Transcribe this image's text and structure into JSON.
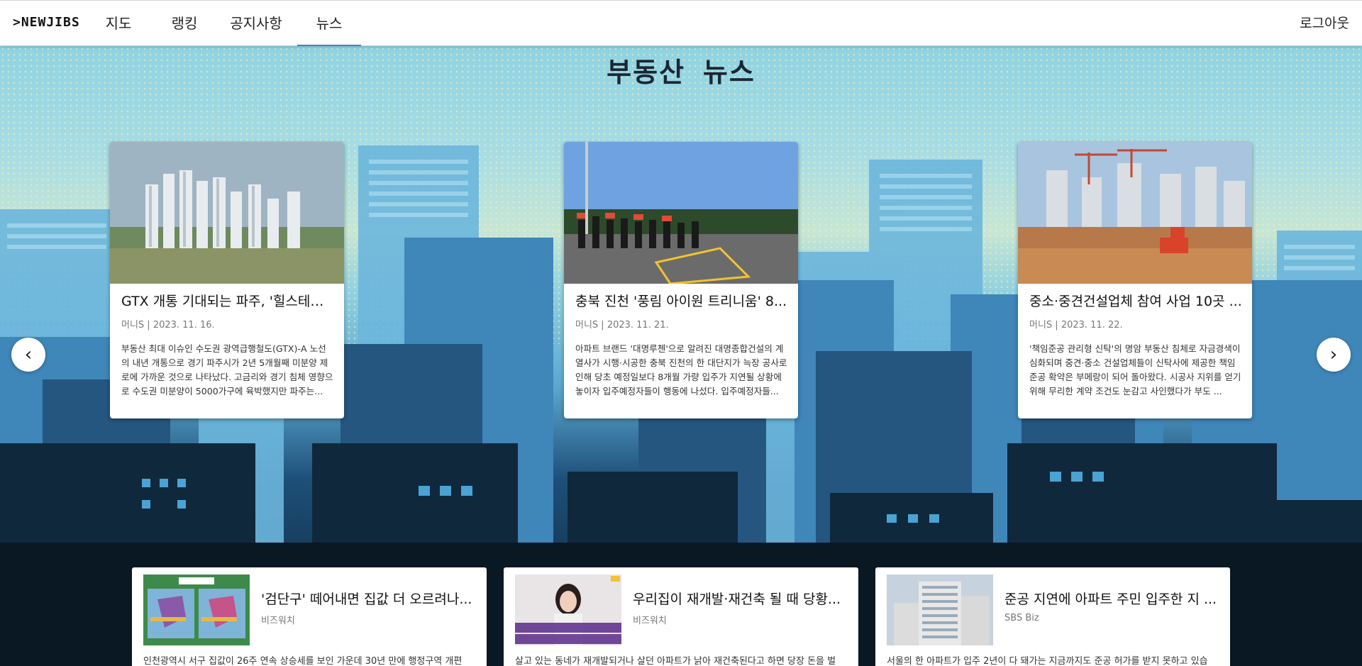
{
  "nav": {
    "logo": ">NEWJIBS",
    "items": [
      {
        "label": "지도"
      },
      {
        "label": "랭킹"
      },
      {
        "label": "공지사항"
      },
      {
        "label": "뉴스"
      }
    ],
    "active": "뉴스",
    "logout": "로그아웃"
  },
  "hero": {
    "title": "부동산 뉴스"
  },
  "cards": [
    {
      "title": "GTX 개통 기대되는 파주, '힐스테이...",
      "meta": "머니S | 2023. 11. 16.",
      "desc": "부동산 최대 이슈인 수도권 광역급행철도(GTX)-A 노선의 내년 개통으로 경기 파주시가 2년 5개월째 미분양 제로에 가까운 것으로 나타났다. 고금리와 경기 침체 영향으로 수도권 미분양이 5000가구에 육박했지만 파주는..."
    },
    {
      "title": "충북 진천 '풍림 아이원 트리니움' 8...",
      "meta": "머니S | 2023. 11. 21.",
      "desc": "아파트 브랜드 '대명루첸'으로 알려진 대명종합건설의 계열사가 시행·시공한 충북 진천의 한 대단지가 늑장 공사로 인해 당초 예정일보다 8개월 가량 입주가 지연될 상황에 놓이자 입주예정자들이 행동에 나섰다. 입주예정자들..."
    },
    {
      "title": "중소·중견건설업체 참여 사업 10곳 ...",
      "meta": "머니S | 2023. 11. 22.",
      "desc": "'책임준공 관리형 신탁'의 명암 부동산 침체로 자금경색이 심화되며 중견·중소 건설업체들이 신탁사에 제공한 책임준공 확약은 부메랑이 되어 돌아왔다. 시공사 지위를 얻기 위해 무리한 계약 조건도 눈감고 사인했다가 부도 ..."
    }
  ],
  "arrows": {
    "prev": "‹",
    "next": "›"
  },
  "news_list": [
    {
      "title": "'검단구' 떼어내면 집값 더 오르려나...",
      "source": "비즈워치",
      "desc": "인천광역시 서구 집값이 26주 연속 상승세를 보인 가운데 30년 만에 행정구역 개편"
    },
    {
      "title": "우리집이 재개발·재건축 될 때 당황...",
      "source": "비즈워치",
      "desc": "살고 있는 동네가 재개발되거나 살던 아파트가 낡아 재건축된다고 하면 당장 돈을 벌"
    },
    {
      "title": "준공 지연에 아파트 주민 입주한 지 ...",
      "source": "SBS Biz",
      "desc": "서울의 한 아파트가 입주 2년이 다 돼가는 지금까지도 준공 허가를 받지 못하고 있습"
    }
  ],
  "colors": {
    "nav_active_underline": "#4a7cd6",
    "sky": "#8fd3e2",
    "night_city": "#0f1f2e"
  }
}
